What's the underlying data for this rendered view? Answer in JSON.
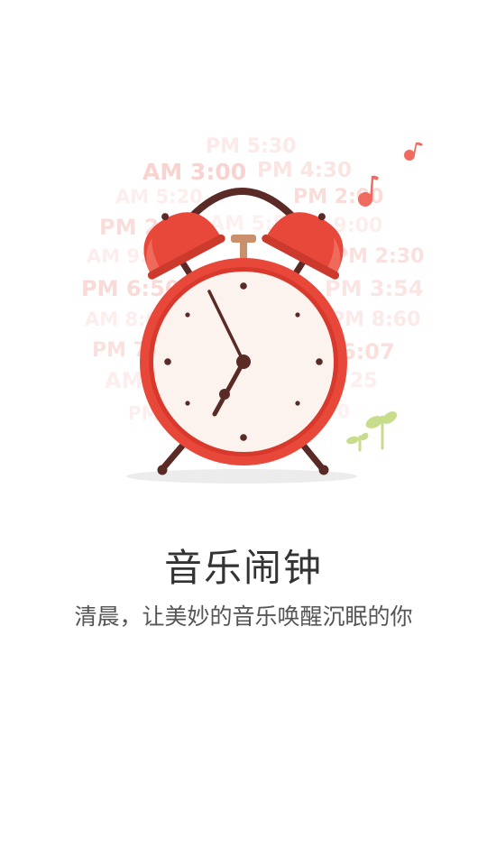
{
  "background_times": [
    "PM 5:30",
    "AM 3:00",
    "PM 4:30",
    "AM 5:20",
    "PM 2:00",
    "PM 2:00",
    "AM 5:55",
    "M 9:00",
    "AM 9:",
    "PM 2:30",
    "PM 6:50",
    "PM 3:54",
    "AM 8:0",
    "PM 8:60",
    "PM 7",
    "6:07",
    "AM",
    "25",
    "PM",
    "0"
  ],
  "colors": {
    "clock_red": "#e8483a",
    "clock_face": "#fcf3ee",
    "hands": "#5a2a26",
    "note": "#ef6a5f",
    "sprout": "#c8dd8c",
    "faded_text": "#f08e82"
  },
  "icons": {
    "clock": "alarm-clock-icon",
    "note_small": "music-note-icon",
    "note_large": "music-note-icon",
    "sprout": "sprout-icon"
  },
  "title": "音乐闹钟",
  "subtitle": "清晨，让美妙的音乐唤醒沉眠的你"
}
